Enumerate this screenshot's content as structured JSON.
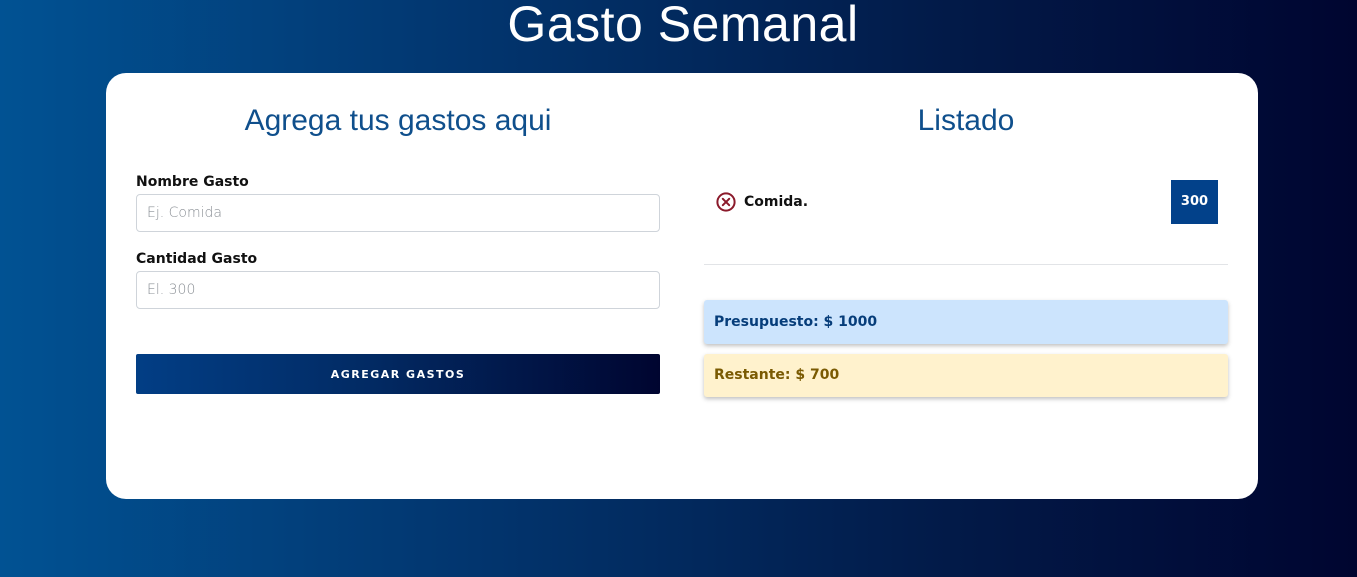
{
  "page": {
    "title": "Gasto Semanal"
  },
  "form": {
    "title": "Agrega tus gastos aqui",
    "name_label": "Nombre Gasto",
    "name_placeholder": "Ej. Comida",
    "amount_label": "Cantidad Gasto",
    "amount_placeholder": "El. 300",
    "submit_label": "Agregar Gastos"
  },
  "list": {
    "title": "Listado",
    "items": [
      {
        "name": "Comida.",
        "amount": "300"
      }
    ],
    "delete_icon": "close-circle-icon",
    "budget_text": "Presupuesto: $ 1000",
    "remaining_text": "Restante: $ 700"
  },
  "colors": {
    "primary": "#02418a",
    "delete_icon": "#8b1a2b",
    "budget_bg": "#cce4fd",
    "remaining_bg": "#fff2cd"
  }
}
